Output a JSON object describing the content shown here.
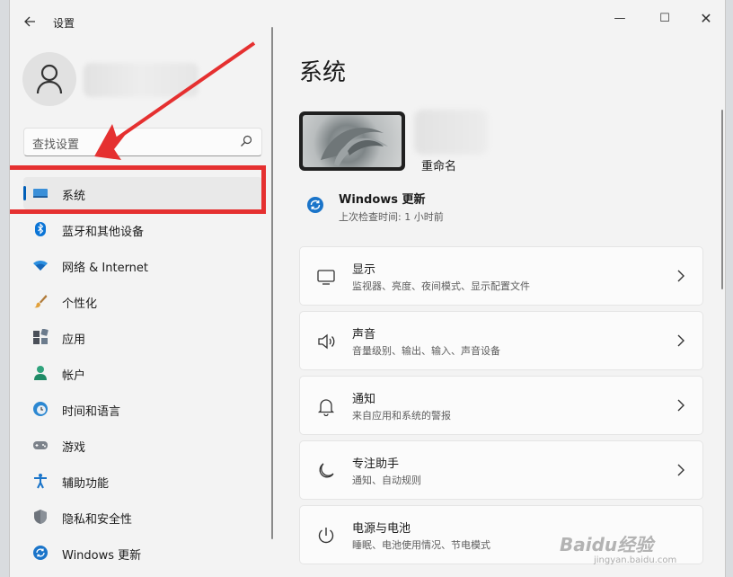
{
  "window": {
    "title": "设置",
    "back_icon": "arrow-left-icon",
    "min_glyph": "—",
    "max_glyph": "☐",
    "close_glyph": "✕"
  },
  "search": {
    "placeholder": "查找设置"
  },
  "sidebar": {
    "items": [
      {
        "label": "系统",
        "icon": "monitor-icon",
        "active": true
      },
      {
        "label": "蓝牙和其他设备",
        "icon": "bluetooth-icon"
      },
      {
        "label": "网络 & Internet",
        "icon": "wifi-icon"
      },
      {
        "label": "个性化",
        "icon": "brush-icon"
      },
      {
        "label": "应用",
        "icon": "apps-icon"
      },
      {
        "label": "帐户",
        "icon": "account-icon"
      },
      {
        "label": "时间和语言",
        "icon": "clock-globe-icon"
      },
      {
        "label": "游戏",
        "icon": "gamepad-icon"
      },
      {
        "label": "辅助功能",
        "icon": "accessibility-icon"
      },
      {
        "label": "隐私和安全性",
        "icon": "shield-icon"
      },
      {
        "label": "Windows 更新",
        "icon": "sync-icon"
      }
    ]
  },
  "main": {
    "title": "系统",
    "device": {
      "rename_label": "重命名"
    },
    "update": {
      "title": "Windows 更新",
      "subtitle": "上次检查时间: 1 小时前"
    },
    "cards": [
      {
        "title": "显示",
        "subtitle": "监视器、亮度、夜间模式、显示配置文件",
        "icon": "display-icon"
      },
      {
        "title": "声音",
        "subtitle": "音量级别、输出、输入、声音设备",
        "icon": "speaker-icon"
      },
      {
        "title": "通知",
        "subtitle": "来自应用和系统的警报",
        "icon": "bell-icon"
      },
      {
        "title": "专注助手",
        "subtitle": "通知、自动规则",
        "icon": "moon-icon"
      },
      {
        "title": "电源与电池",
        "subtitle": "睡眠、电池使用情况、节电模式",
        "icon": "power-icon"
      }
    ]
  },
  "watermark": {
    "text": "Baidu经验",
    "sub": "jingyan.baidu.com"
  },
  "colors": {
    "accent": "#005fb8",
    "highlight": "#e53030",
    "background": "#f3f3f3"
  }
}
